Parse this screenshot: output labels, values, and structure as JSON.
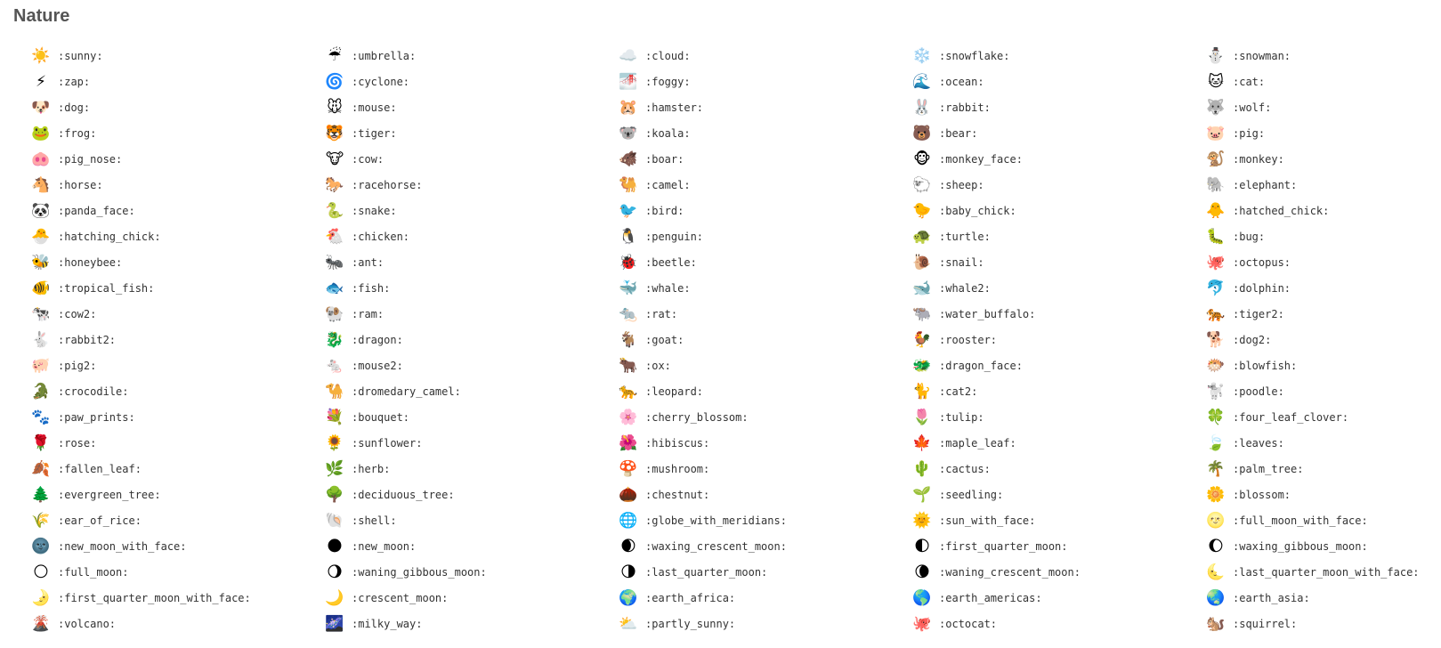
{
  "section": {
    "title": "Nature"
  },
  "emojis": [
    {
      "code": ":sunny:",
      "glyph": "☀️",
      "icon": "sunny-icon"
    },
    {
      "code": ":umbrella:",
      "glyph": "☔",
      "icon": "umbrella-icon"
    },
    {
      "code": ":cloud:",
      "glyph": "☁️",
      "icon": "cloud-icon"
    },
    {
      "code": ":snowflake:",
      "glyph": "❄️",
      "icon": "snowflake-icon"
    },
    {
      "code": ":snowman:",
      "glyph": "⛄",
      "icon": "snowman-icon"
    },
    {
      "code": ":zap:",
      "glyph": "⚡",
      "icon": "zap-icon"
    },
    {
      "code": ":cyclone:",
      "glyph": "🌀",
      "icon": "cyclone-icon"
    },
    {
      "code": ":foggy:",
      "glyph": "🌁",
      "icon": "foggy-icon"
    },
    {
      "code": ":ocean:",
      "glyph": "🌊",
      "icon": "ocean-icon"
    },
    {
      "code": ":cat:",
      "glyph": "🐱",
      "icon": "cat-icon"
    },
    {
      "code": ":dog:",
      "glyph": "🐶",
      "icon": "dog-icon"
    },
    {
      "code": ":mouse:",
      "glyph": "🐭",
      "icon": "mouse-icon"
    },
    {
      "code": ":hamster:",
      "glyph": "🐹",
      "icon": "hamster-icon"
    },
    {
      "code": ":rabbit:",
      "glyph": "🐰",
      "icon": "rabbit-icon"
    },
    {
      "code": ":wolf:",
      "glyph": "🐺",
      "icon": "wolf-icon"
    },
    {
      "code": ":frog:",
      "glyph": "🐸",
      "icon": "frog-icon"
    },
    {
      "code": ":tiger:",
      "glyph": "🐯",
      "icon": "tiger-icon"
    },
    {
      "code": ":koala:",
      "glyph": "🐨",
      "icon": "koala-icon"
    },
    {
      "code": ":bear:",
      "glyph": "🐻",
      "icon": "bear-icon"
    },
    {
      "code": ":pig:",
      "glyph": "🐷",
      "icon": "pig-icon"
    },
    {
      "code": ":pig_nose:",
      "glyph": "🐽",
      "icon": "pig-nose-icon"
    },
    {
      "code": ":cow:",
      "glyph": "🐮",
      "icon": "cow-icon"
    },
    {
      "code": ":boar:",
      "glyph": "🐗",
      "icon": "boar-icon"
    },
    {
      "code": ":monkey_face:",
      "glyph": "🐵",
      "icon": "monkey-face-icon"
    },
    {
      "code": ":monkey:",
      "glyph": "🐒",
      "icon": "monkey-icon"
    },
    {
      "code": ":horse:",
      "glyph": "🐴",
      "icon": "horse-icon"
    },
    {
      "code": ":racehorse:",
      "glyph": "🐎",
      "icon": "racehorse-icon"
    },
    {
      "code": ":camel:",
      "glyph": "🐫",
      "icon": "camel-icon"
    },
    {
      "code": ":sheep:",
      "glyph": "🐑",
      "icon": "sheep-icon"
    },
    {
      "code": ":elephant:",
      "glyph": "🐘",
      "icon": "elephant-icon"
    },
    {
      "code": ":panda_face:",
      "glyph": "🐼",
      "icon": "panda-face-icon"
    },
    {
      "code": ":snake:",
      "glyph": "🐍",
      "icon": "snake-icon"
    },
    {
      "code": ":bird:",
      "glyph": "🐦",
      "icon": "bird-icon"
    },
    {
      "code": ":baby_chick:",
      "glyph": "🐤",
      "icon": "baby-chick-icon"
    },
    {
      "code": ":hatched_chick:",
      "glyph": "🐥",
      "icon": "hatched-chick-icon"
    },
    {
      "code": ":hatching_chick:",
      "glyph": "🐣",
      "icon": "hatching-chick-icon"
    },
    {
      "code": ":chicken:",
      "glyph": "🐔",
      "icon": "chicken-icon"
    },
    {
      "code": ":penguin:",
      "glyph": "🐧",
      "icon": "penguin-icon"
    },
    {
      "code": ":turtle:",
      "glyph": "🐢",
      "icon": "turtle-icon"
    },
    {
      "code": ":bug:",
      "glyph": "🐛",
      "icon": "bug-icon"
    },
    {
      "code": ":honeybee:",
      "glyph": "🐝",
      "icon": "honeybee-icon"
    },
    {
      "code": ":ant:",
      "glyph": "🐜",
      "icon": "ant-icon"
    },
    {
      "code": ":beetle:",
      "glyph": "🐞",
      "icon": "beetle-icon"
    },
    {
      "code": ":snail:",
      "glyph": "🐌",
      "icon": "snail-icon"
    },
    {
      "code": ":octopus:",
      "glyph": "🐙",
      "icon": "octopus-icon"
    },
    {
      "code": ":tropical_fish:",
      "glyph": "🐠",
      "icon": "tropical-fish-icon"
    },
    {
      "code": ":fish:",
      "glyph": "🐟",
      "icon": "fish-icon"
    },
    {
      "code": ":whale:",
      "glyph": "🐳",
      "icon": "whale-icon"
    },
    {
      "code": ":whale2:",
      "glyph": "🐋",
      "icon": "whale2-icon"
    },
    {
      "code": ":dolphin:",
      "glyph": "🐬",
      "icon": "dolphin-icon"
    },
    {
      "code": ":cow2:",
      "glyph": "🐄",
      "icon": "cow2-icon"
    },
    {
      "code": ":ram:",
      "glyph": "🐏",
      "icon": "ram-icon"
    },
    {
      "code": ":rat:",
      "glyph": "🐀",
      "icon": "rat-icon"
    },
    {
      "code": ":water_buffalo:",
      "glyph": "🐃",
      "icon": "water-buffalo-icon"
    },
    {
      "code": ":tiger2:",
      "glyph": "🐅",
      "icon": "tiger2-icon"
    },
    {
      "code": ":rabbit2:",
      "glyph": "🐇",
      "icon": "rabbit2-icon"
    },
    {
      "code": ":dragon:",
      "glyph": "🐉",
      "icon": "dragon-icon"
    },
    {
      "code": ":goat:",
      "glyph": "🐐",
      "icon": "goat-icon"
    },
    {
      "code": ":rooster:",
      "glyph": "🐓",
      "icon": "rooster-icon"
    },
    {
      "code": ":dog2:",
      "glyph": "🐕",
      "icon": "dog2-icon"
    },
    {
      "code": ":pig2:",
      "glyph": "🐖",
      "icon": "pig2-icon"
    },
    {
      "code": ":mouse2:",
      "glyph": "🐁",
      "icon": "mouse2-icon"
    },
    {
      "code": ":ox:",
      "glyph": "🐂",
      "icon": "ox-icon"
    },
    {
      "code": ":dragon_face:",
      "glyph": "🐲",
      "icon": "dragon-face-icon"
    },
    {
      "code": ":blowfish:",
      "glyph": "🐡",
      "icon": "blowfish-icon"
    },
    {
      "code": ":crocodile:",
      "glyph": "🐊",
      "icon": "crocodile-icon"
    },
    {
      "code": ":dromedary_camel:",
      "glyph": "🐪",
      "icon": "dromedary-camel-icon"
    },
    {
      "code": ":leopard:",
      "glyph": "🐆",
      "icon": "leopard-icon"
    },
    {
      "code": ":cat2:",
      "glyph": "🐈",
      "icon": "cat2-icon"
    },
    {
      "code": ":poodle:",
      "glyph": "🐩",
      "icon": "poodle-icon"
    },
    {
      "code": ":paw_prints:",
      "glyph": "🐾",
      "icon": "paw-prints-icon"
    },
    {
      "code": ":bouquet:",
      "glyph": "💐",
      "icon": "bouquet-icon"
    },
    {
      "code": ":cherry_blossom:",
      "glyph": "🌸",
      "icon": "cherry-blossom-icon"
    },
    {
      "code": ":tulip:",
      "glyph": "🌷",
      "icon": "tulip-icon"
    },
    {
      "code": ":four_leaf_clover:",
      "glyph": "🍀",
      "icon": "four-leaf-clover-icon"
    },
    {
      "code": ":rose:",
      "glyph": "🌹",
      "icon": "rose-icon"
    },
    {
      "code": ":sunflower:",
      "glyph": "🌻",
      "icon": "sunflower-icon"
    },
    {
      "code": ":hibiscus:",
      "glyph": "🌺",
      "icon": "hibiscus-icon"
    },
    {
      "code": ":maple_leaf:",
      "glyph": "🍁",
      "icon": "maple-leaf-icon"
    },
    {
      "code": ":leaves:",
      "glyph": "🍃",
      "icon": "leaves-icon"
    },
    {
      "code": ":fallen_leaf:",
      "glyph": "🍂",
      "icon": "fallen-leaf-icon"
    },
    {
      "code": ":herb:",
      "glyph": "🌿",
      "icon": "herb-icon"
    },
    {
      "code": ":mushroom:",
      "glyph": "🍄",
      "icon": "mushroom-icon"
    },
    {
      "code": ":cactus:",
      "glyph": "🌵",
      "icon": "cactus-icon"
    },
    {
      "code": ":palm_tree:",
      "glyph": "🌴",
      "icon": "palm-tree-icon"
    },
    {
      "code": ":evergreen_tree:",
      "glyph": "🌲",
      "icon": "evergreen-tree-icon"
    },
    {
      "code": ":deciduous_tree:",
      "glyph": "🌳",
      "icon": "deciduous-tree-icon"
    },
    {
      "code": ":chestnut:",
      "glyph": "🌰",
      "icon": "chestnut-icon"
    },
    {
      "code": ":seedling:",
      "glyph": "🌱",
      "icon": "seedling-icon"
    },
    {
      "code": ":blossom:",
      "glyph": "🌼",
      "icon": "blossom-icon"
    },
    {
      "code": ":ear_of_rice:",
      "glyph": "🌾",
      "icon": "ear-of-rice-icon"
    },
    {
      "code": ":shell:",
      "glyph": "🐚",
      "icon": "shell-icon"
    },
    {
      "code": ":globe_with_meridians:",
      "glyph": "🌐",
      "icon": "globe-with-meridians-icon"
    },
    {
      "code": ":sun_with_face:",
      "glyph": "🌞",
      "icon": "sun-with-face-icon"
    },
    {
      "code": ":full_moon_with_face:",
      "glyph": "🌝",
      "icon": "full-moon-with-face-icon"
    },
    {
      "code": ":new_moon_with_face:",
      "glyph": "🌚",
      "icon": "new-moon-with-face-icon"
    },
    {
      "code": ":new_moon:",
      "glyph": "🌑",
      "icon": "new-moon-icon"
    },
    {
      "code": ":waxing_crescent_moon:",
      "glyph": "🌒",
      "icon": "waxing-crescent-moon-icon"
    },
    {
      "code": ":first_quarter_moon:",
      "glyph": "🌓",
      "icon": "first-quarter-moon-icon"
    },
    {
      "code": ":waxing_gibbous_moon:",
      "glyph": "🌔",
      "icon": "waxing-gibbous-moon-icon"
    },
    {
      "code": ":full_moon:",
      "glyph": "🌕",
      "icon": "full-moon-icon"
    },
    {
      "code": ":waning_gibbous_moon:",
      "glyph": "🌖",
      "icon": "waning-gibbous-moon-icon"
    },
    {
      "code": ":last_quarter_moon:",
      "glyph": "🌗",
      "icon": "last-quarter-moon-icon"
    },
    {
      "code": ":waning_crescent_moon:",
      "glyph": "🌘",
      "icon": "waning-crescent-moon-icon"
    },
    {
      "code": ":last_quarter_moon_with_face:",
      "glyph": "🌜",
      "icon": "last-quarter-moon-with-face-icon"
    },
    {
      "code": ":first_quarter_moon_with_face:",
      "glyph": "🌛",
      "icon": "first-quarter-moon-with-face-icon"
    },
    {
      "code": ":crescent_moon:",
      "glyph": "🌙",
      "icon": "crescent-moon-icon"
    },
    {
      "code": ":earth_africa:",
      "glyph": "🌍",
      "icon": "earth-africa-icon"
    },
    {
      "code": ":earth_americas:",
      "glyph": "🌎",
      "icon": "earth-americas-icon"
    },
    {
      "code": ":earth_asia:",
      "glyph": "🌏",
      "icon": "earth-asia-icon"
    },
    {
      "code": ":volcano:",
      "glyph": "🌋",
      "icon": "volcano-icon"
    },
    {
      "code": ":milky_way:",
      "glyph": "🌌",
      "icon": "milky-way-icon"
    },
    {
      "code": ":partly_sunny:",
      "glyph": "⛅",
      "icon": "partly-sunny-icon"
    },
    {
      "code": ":octocat:",
      "glyph": "🐙",
      "icon": "octocat-icon"
    },
    {
      "code": ":squirrel:",
      "glyph": "🐿️",
      "icon": "squirrel-icon"
    }
  ]
}
